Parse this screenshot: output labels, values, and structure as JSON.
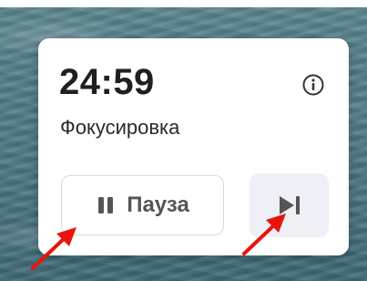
{
  "timer": {
    "time": "24:59",
    "mode": "Фокусировка"
  },
  "controls": {
    "pause_label": "Пауза"
  },
  "icons": {
    "info": "info-icon",
    "pause": "pause-icon",
    "skip": "skip-next-icon",
    "annotation": "red-arrow-icon"
  },
  "colors": {
    "arrow": "#e8140c",
    "skip_bg": "#eef0f6",
    "text": "#1f1f1f"
  }
}
